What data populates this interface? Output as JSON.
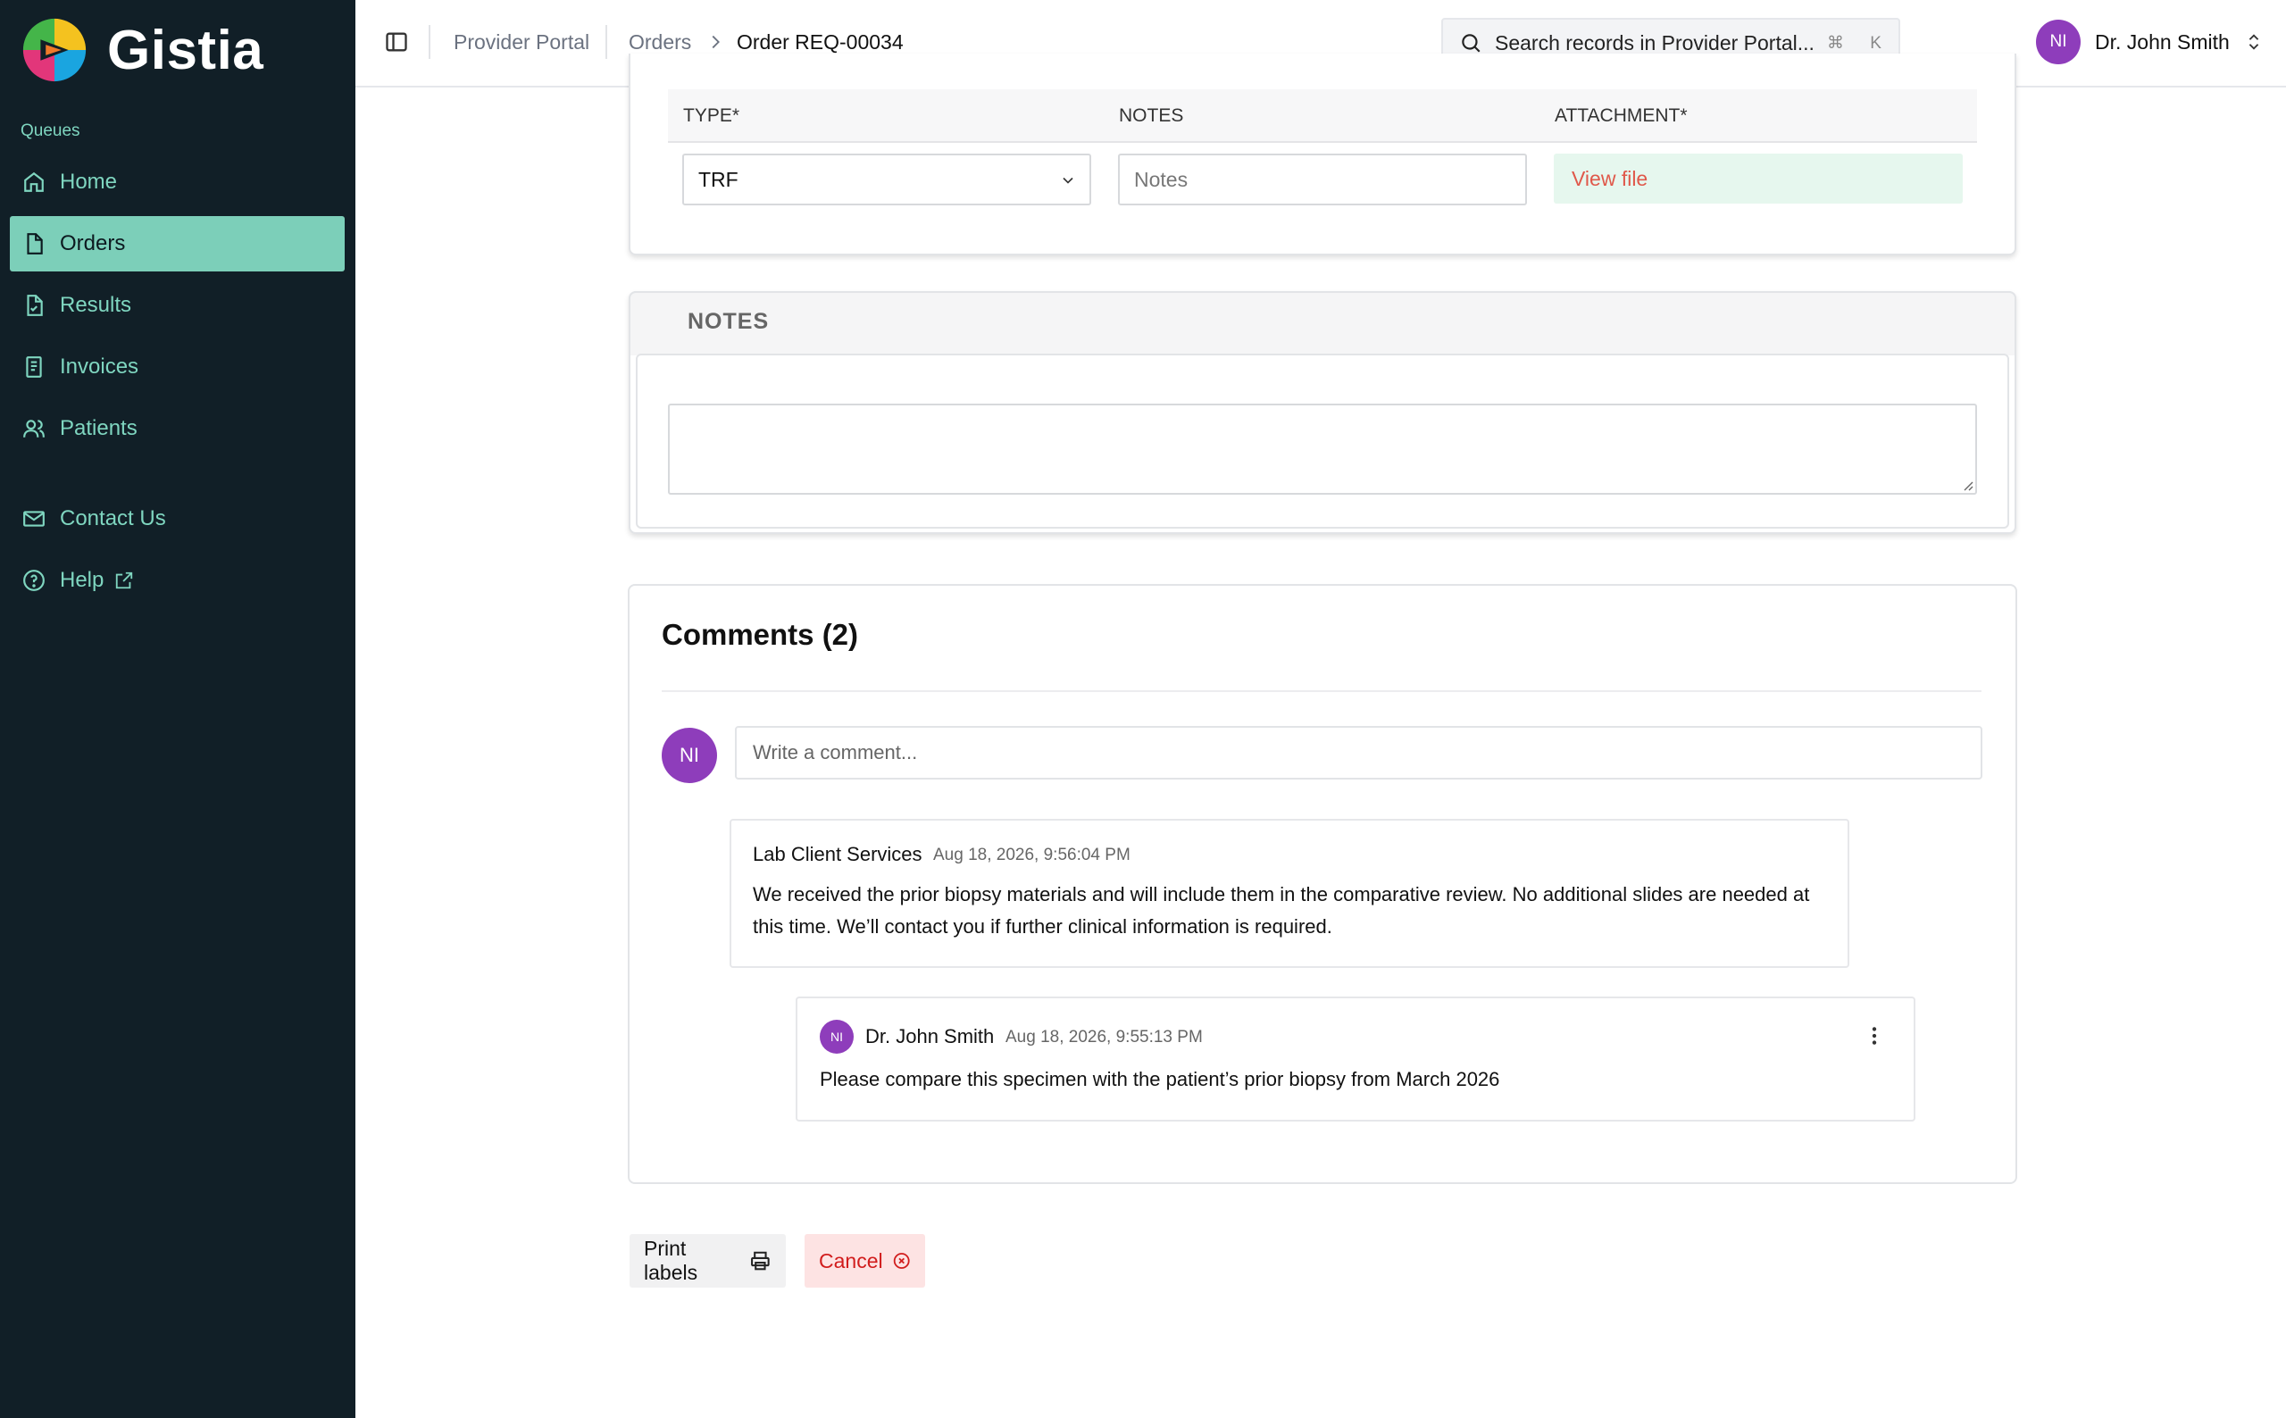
{
  "brand": {
    "name": "Gistia"
  },
  "sidebar": {
    "section_label": "Queues",
    "items": [
      {
        "label": "Home",
        "icon": "home-icon"
      },
      {
        "label": "Orders",
        "icon": "file-icon",
        "active": true
      },
      {
        "label": "Results",
        "icon": "file-check-icon"
      },
      {
        "label": "Invoices",
        "icon": "receipt-icon"
      },
      {
        "label": "Patients",
        "icon": "users-icon"
      },
      {
        "label": "Contact Us",
        "icon": "mail-icon"
      },
      {
        "label": "Help",
        "icon": "help-circle-icon"
      }
    ]
  },
  "header": {
    "breadcrumb": [
      "Provider Portal",
      "Orders",
      "Order REQ-00034"
    ],
    "search": {
      "placeholder": "Search records in Provider Portal...",
      "shortcut": "⌘ K"
    },
    "user": {
      "initials": "NI",
      "name": "Dr. John Smith"
    }
  },
  "attachments": {
    "columns": [
      "TYPE*",
      "NOTES",
      "ATTACHMENT*"
    ],
    "row": {
      "type": "TRF",
      "notes_placeholder": "Notes",
      "attachment_link": "View file"
    }
  },
  "notes": {
    "title": "NOTES",
    "value": ""
  },
  "comments": {
    "title": "Comments (2)",
    "input_placeholder": "Write a comment...",
    "current_user_initials": "NI",
    "items": [
      {
        "author": "Lab Client Services",
        "timestamp": "Aug 18, 2026, 9:56:04 PM",
        "body": "We received the prior biopsy materials and will include them in the comparative review. No additional slides are needed at this time. We’ll contact you if further clinical information is required."
      },
      {
        "author": "Dr. John Smith",
        "initials": "NI",
        "timestamp": "Aug 18, 2026, 9:55:13 PM",
        "body": "Please compare this specimen with the patient’s prior biopsy from March 2026"
      }
    ]
  },
  "actions": {
    "print_label": "Print labels",
    "cancel_label": "Cancel"
  },
  "colors": {
    "sidebar_bg": "#111f27",
    "accent": "#7ccfb9",
    "avatar": "#8e3dbb",
    "danger": "#d11c1c"
  }
}
